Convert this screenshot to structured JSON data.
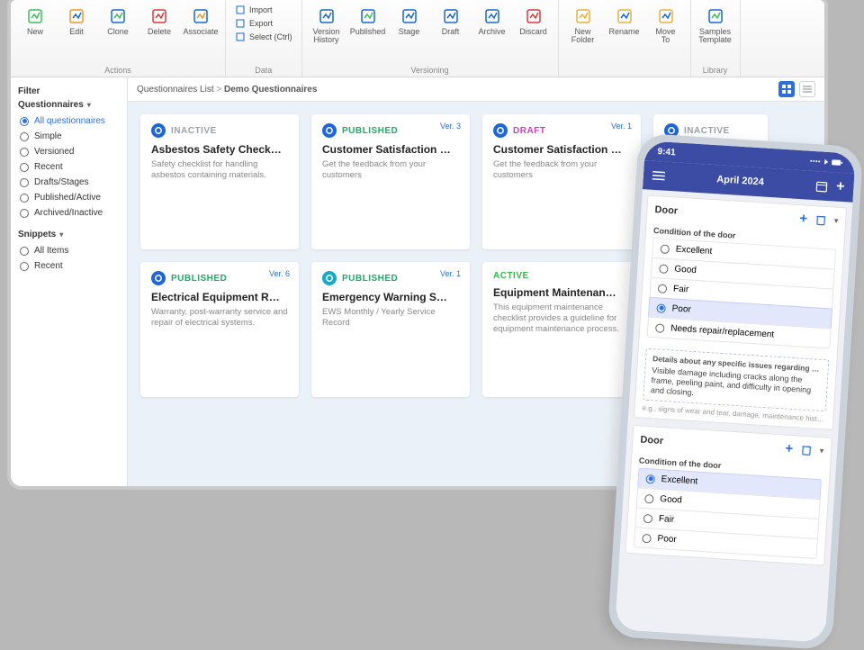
{
  "ribbon": {
    "actions": {
      "name": "Actions",
      "buttons": [
        {
          "key": "new",
          "label": "New"
        },
        {
          "key": "edit",
          "label": "Edit"
        },
        {
          "key": "clone",
          "label": "Clone"
        },
        {
          "key": "delete",
          "label": "Delete"
        },
        {
          "key": "associate",
          "label": "Associate"
        }
      ]
    },
    "data": {
      "name": "Data",
      "items": [
        {
          "key": "import",
          "label": "Import"
        },
        {
          "key": "export",
          "label": "Export"
        },
        {
          "key": "select",
          "label": "Select (Ctrl)"
        }
      ]
    },
    "versioning": {
      "name": "Versioning",
      "buttons": [
        {
          "key": "version-history",
          "label": "Version History"
        },
        {
          "key": "published",
          "label": "Published"
        },
        {
          "key": "stage",
          "label": "Stage"
        },
        {
          "key": "draft",
          "label": "Draft"
        },
        {
          "key": "archive",
          "label": "Archive"
        },
        {
          "key": "discard",
          "label": "Discard"
        }
      ]
    },
    "folder": {
      "name": "",
      "buttons": [
        {
          "key": "new-folder",
          "label": "New Folder"
        },
        {
          "key": "rename",
          "label": "Rename"
        },
        {
          "key": "move-to",
          "label": "Move To"
        }
      ]
    },
    "library": {
      "name": "Library",
      "buttons": [
        {
          "key": "samples-template",
          "label": "Samples Template"
        }
      ]
    }
  },
  "sidebar": {
    "filterTitle": "Filter",
    "questionnairesTitle": "Questionnaires",
    "snippetsTitle": "Snippets",
    "filters": [
      {
        "label": "All questionnaires",
        "selected": true
      },
      {
        "label": "Simple"
      },
      {
        "label": "Versioned"
      },
      {
        "label": "Recent"
      },
      {
        "label": "Drafts/Stages"
      },
      {
        "label": "Published/Active"
      },
      {
        "label": "Archived/Inactive"
      }
    ],
    "snippets": [
      {
        "label": "All Items"
      },
      {
        "label": "Recent"
      }
    ]
  },
  "breadcrumb": {
    "root": "Questionnaires List",
    "here": "Demo Questionnaires"
  },
  "cards": [
    {
      "status": "INACTIVE",
      "cls": "st-inactive",
      "icon": "blue",
      "title": "Asbestos Safety Check…",
      "desc": "Safety checklist for handling asbestos containing materials."
    },
    {
      "status": "PUBLISHED",
      "cls": "st-published",
      "icon": "blue",
      "title": "Customer Satisfaction …",
      "desc": "Get the feedback from your customers",
      "ver": "Ver. 3"
    },
    {
      "status": "DRAFT",
      "cls": "st-draft",
      "icon": "blue",
      "title": "Customer Satisfaction …",
      "desc": "Get the feedback from your customers",
      "ver": "Ver. 1"
    },
    {
      "status": "INACTIVE",
      "cls": "st-inactive",
      "icon": "blue",
      "title": "",
      "desc": "",
      "cut": true
    },
    {
      "status": "PUBLISHED",
      "cls": "st-published",
      "icon": "blue",
      "title": "Electrical Equipment R…",
      "desc": "Warranty, post-warranty service and repair of electrical systems.",
      "ver": "Ver. 6"
    },
    {
      "status": "PUBLISHED",
      "cls": "st-published",
      "icon": "teal",
      "title": "Emergency Warning S…",
      "desc": "EWS Monthly / Yearly Service Record",
      "ver": "Ver. 1"
    },
    {
      "status": "ACTIVE",
      "cls": "st-active",
      "icon": "none",
      "title": "Equipment Maintenan…",
      "desc": "This equipment maintenance checklist provides a guideline for equipment maintenance process."
    }
  ],
  "phone": {
    "time": "9:41",
    "title": "April 2024",
    "section1": {
      "title": "Door",
      "question": "Condition of the door",
      "options": [
        {
          "label": "Excellent"
        },
        {
          "label": "Good"
        },
        {
          "label": "Fair"
        },
        {
          "label": "Poor",
          "selected": true
        },
        {
          "label": "Needs repair/replacement"
        }
      ],
      "detailsLabel": "Details about any specific issues regarding the conditio…",
      "detailsText": "Visible damage including cracks along the frame, peeling paint, and difficulty in opening and closing.",
      "detailsHint": "e.g., signs of wear and tear, damage, maintenance history, etc."
    },
    "section2": {
      "title": "Door",
      "question": "Condition of the door",
      "options": [
        {
          "label": "Excellent",
          "selected": true
        },
        {
          "label": "Good"
        },
        {
          "label": "Fair"
        },
        {
          "label": "Poor"
        }
      ]
    }
  }
}
